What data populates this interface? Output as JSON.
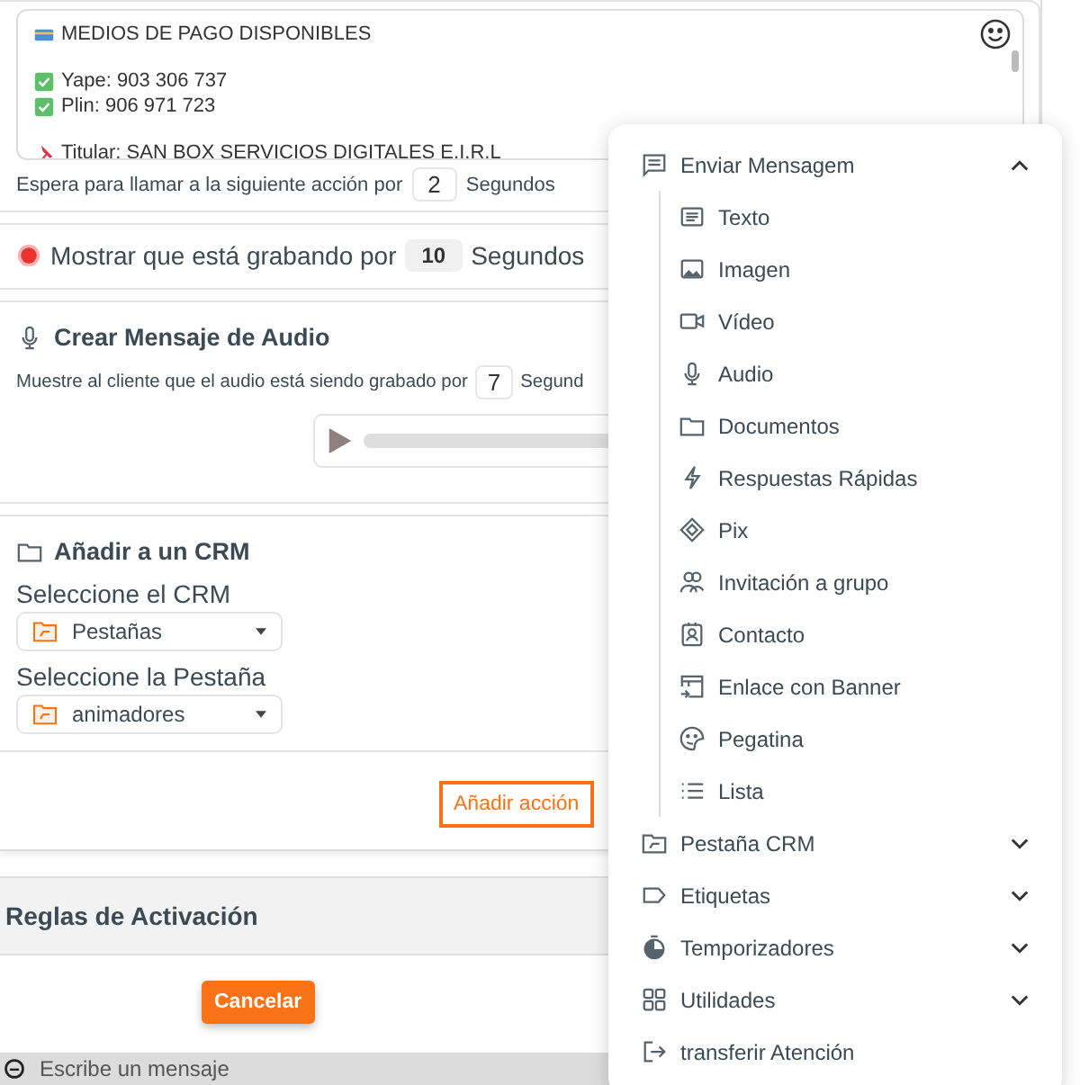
{
  "message_box": {
    "lines": [
      {
        "kind": "card",
        "text": "MEDIOS DE PAGO DISPONIBLES",
        "gap_before": false
      },
      {
        "kind": "check",
        "text": "Yape: 903 306 737",
        "gap_before": true
      },
      {
        "kind": "check",
        "text": "Plin: 906 971 723",
        "gap_before": false
      },
      {
        "kind": "pin",
        "text": "Titular: SAN BOX SERVICIOS DIGITALES E.I.R.L",
        "gap_before": true
      }
    ]
  },
  "wait": {
    "label": "Espera para llamar a la siguiente acción por",
    "value": "2",
    "unit": "Segundos"
  },
  "recording": {
    "label": "Mostrar que está grabando por",
    "value": "10",
    "unit": "Segundos"
  },
  "audio": {
    "title": "Crear Mensaje de Audio",
    "label": "Muestre al cliente que el audio está siendo grabado por",
    "value": "7",
    "unit": "Segund",
    "player": {
      "level": 0
    }
  },
  "crm": {
    "title": "Añadir a un CRM",
    "fields": [
      {
        "label": "Seleccione el CRM",
        "value": "Pestañas"
      },
      {
        "label": "Seleccione la Pestaña",
        "value": "animadores"
      }
    ]
  },
  "add_action_button": "Añadir acción",
  "rules": {
    "title": "Reglas de Activación"
  },
  "cancel_button": "Cancelar",
  "composer": {
    "placeholder": "Escribe un mensaje"
  },
  "menu": {
    "sections": [
      {
        "kind": "message",
        "label": "Enviar Mensagem",
        "expanded": true,
        "children": [
          {
            "kind": "text",
            "label": "Texto"
          },
          {
            "kind": "image",
            "label": "Imagen"
          },
          {
            "kind": "video",
            "label": "Vídeo"
          },
          {
            "kind": "audio",
            "label": "Audio"
          },
          {
            "kind": "docs",
            "label": "Documentos"
          },
          {
            "kind": "bolt",
            "label": "Respuestas Rápidas"
          },
          {
            "kind": "pix",
            "label": "Pix"
          },
          {
            "kind": "group",
            "label": "Invitación a grupo"
          },
          {
            "kind": "contact",
            "label": "Contacto"
          },
          {
            "kind": "banner",
            "label": "Enlace con Banner"
          },
          {
            "kind": "sticker",
            "label": "Pegatina"
          },
          {
            "kind": "list",
            "label": "Lista"
          }
        ]
      },
      {
        "kind": "folder",
        "label": "Pestaña CRM",
        "expanded": false
      },
      {
        "kind": "tag",
        "label": "Etiquetas",
        "expanded": false
      },
      {
        "kind": "timer",
        "label": "Temporizadores",
        "expanded": false
      },
      {
        "kind": "grid",
        "label": "Utilidades",
        "expanded": false
      },
      {
        "kind": "transfer",
        "label": "transferir Atención"
      }
    ]
  }
}
